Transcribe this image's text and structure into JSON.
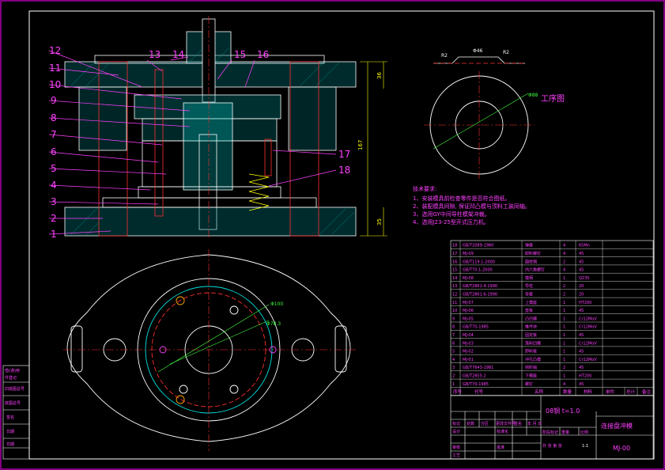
{
  "drawing": {
    "title": "连接盘冲模",
    "drawing_no": "MJ-00",
    "material": "08钢  t=1.0",
    "scale": "1:1",
    "part_view_label": "工序图"
  },
  "dimensions": {
    "part_width": "Φ46",
    "part_top": "R2",
    "part_right": "R2",
    "part_dia": "Φ88",
    "overall_height": "167",
    "upper_height": "36",
    "lower_height": "35",
    "plan_dia_1": "Φ100",
    "plan_dia_2": "Φ78.3"
  },
  "balloons": [
    "1",
    "2",
    "3",
    "4",
    "5",
    "6",
    "7",
    "8",
    "9",
    "10",
    "11",
    "12",
    "13",
    "14",
    "15",
    "16",
    "17",
    "18"
  ],
  "tech_req": {
    "title": "技术要求:",
    "items": [
      "1、安装模具前检查零件是否符合图纸。",
      "2、装配模具间隙, 保证凹凸模与顶料工装同轴。",
      "3、选用GY中间导柱模架冲裁。",
      "4、选用J23-25型开式压力机。"
    ]
  },
  "bom": {
    "headers": [
      "序号",
      "代号",
      "名称",
      "数量",
      "材料",
      "单件",
      "总计",
      "备注"
    ],
    "rows": [
      [
        "18",
        "GB/T2089-1980",
        "弹簧",
        "4",
        "65Mn"
      ],
      [
        "17",
        "MJ-09",
        "卸料螺钉",
        "4",
        "45"
      ],
      [
        "16",
        "GB/T119.1-2000",
        "圆柱销",
        "2",
        "45"
      ],
      [
        "15",
        "GB/T70.1-2000",
        "内六角螺钉",
        "4",
        "45"
      ],
      [
        "14",
        "MJ-08",
        "模柄",
        "1",
        "Q235"
      ],
      [
        "13",
        "GB/T2861.4-1990",
        "导柱",
        "2",
        "20"
      ],
      [
        "12",
        "GB/T2861.6-1990",
        "导套",
        "2",
        "20"
      ],
      [
        "11",
        "MJ-07",
        "上模座",
        "1",
        "HT200"
      ],
      [
        "10",
        "MJ-06",
        "垫板",
        "1",
        "45"
      ],
      [
        "9",
        "MJ-05",
        "凸凹模",
        "1",
        "Cr12MoV"
      ],
      [
        "8",
        "GB/T70-1985",
        "推件块",
        "1",
        "Cr12MoV"
      ],
      [
        "7",
        "MJ-04",
        "固定板",
        "1",
        "45"
      ],
      [
        "6",
        "MJ-03",
        "落料凹模",
        "1",
        "Cr12MoV"
      ],
      [
        "5",
        "MJ-02",
        "卸料板",
        "1",
        "45"
      ],
      [
        "4",
        "MJ-01",
        "冲孔凸模",
        "1",
        "Cr12MoV"
      ],
      [
        "3",
        "GB/T7643-1981",
        "挡料销",
        "2",
        "45"
      ],
      [
        "2",
        "GB/T2855.2",
        "下模座",
        "1",
        "HT200"
      ],
      [
        "1",
        "GB/T70-1985",
        "螺钉",
        "4",
        "45"
      ]
    ]
  },
  "title_block": {
    "mark_label": "标记",
    "count_label": "处数",
    "zone_label": "分区",
    "change_label": "更改文件号",
    "sign_label": "签名",
    "date_label": "年 月 日",
    "stage_label": "阶段标记",
    "weight_label": "重量",
    "scale_label": "比例",
    "design_label": "设计",
    "standard_label": "标准化",
    "check_label": "审核",
    "process_label": "工艺",
    "approve_label": "批准",
    "sheet_label": "共 张 第 张"
  },
  "side_panel": [
    "借(通)用",
    "件登记",
    "旧底图总号",
    "底图总号",
    "签名",
    "日期",
    "日期"
  ]
}
